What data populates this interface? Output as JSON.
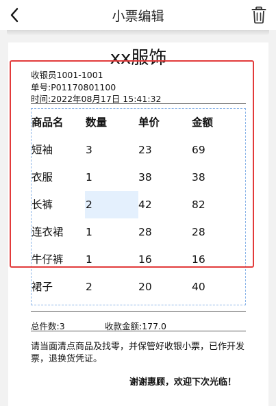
{
  "header": {
    "title": "小票编辑",
    "back_icon": "chevron-left-icon",
    "delete_icon": "trash-icon"
  },
  "receipt": {
    "shop_name": "xx服饰",
    "cashier": "收银员1001-1001",
    "order_no": "单号:P01170801100",
    "time": "时间:2022年08月17日 15:41:32",
    "columns": [
      "商品名",
      "数量",
      "单价",
      "金额"
    ],
    "items": [
      {
        "name": "短袖",
        "qty": "3",
        "price": "23",
        "amount": "69"
      },
      {
        "name": "衣服",
        "qty": "1",
        "price": "38",
        "amount": "38"
      },
      {
        "name": "长裤",
        "qty": "2",
        "price": "42",
        "amount": "82"
      },
      {
        "name": "连衣裙",
        "qty": "1",
        "price": "28",
        "amount": "28"
      },
      {
        "name": "牛仔裤",
        "qty": "1",
        "price": "16",
        "amount": "16"
      },
      {
        "name": "裙子",
        "qty": "2",
        "price": "20",
        "amount": "40"
      }
    ],
    "total_count": "总件数:3",
    "total_amount": "收款金额:177.0",
    "notice": "请当面清点商品及找零，并保管好收银小票，已作开发票，退换货凭证。",
    "thanks": "谢谢惠顾，欢迎下次光临！"
  },
  "colors": {
    "highlight_frame": "#e23a3a",
    "selection_fill": "#e4f0fd",
    "dashed_border": "#8ab4e8"
  }
}
